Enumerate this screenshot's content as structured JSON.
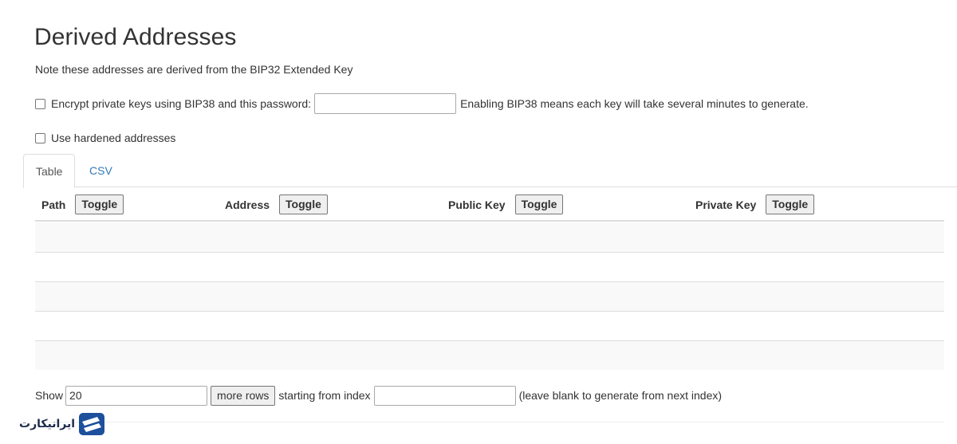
{
  "section": {
    "title": "Derived Addresses",
    "note": "Note these addresses are derived from the BIP32 Extended Key"
  },
  "options": {
    "encrypt_label": "Encrypt private keys using BIP38 and this password:",
    "encrypt_checked": false,
    "password_value": "",
    "encrypt_hint": "Enabling BIP38 means each key will take several minutes to generate.",
    "hardened_label": "Use hardened addresses",
    "hardened_checked": false
  },
  "tabs": [
    {
      "label": "Table",
      "active": true
    },
    {
      "label": "CSV",
      "active": false
    }
  ],
  "table": {
    "columns": [
      {
        "label": "Path",
        "toggle_label": "Toggle"
      },
      {
        "label": "Address",
        "toggle_label": "Toggle"
      },
      {
        "label": "Public Key",
        "toggle_label": "Toggle"
      },
      {
        "label": "Private Key",
        "toggle_label": "Toggle"
      }
    ],
    "rows": []
  },
  "footer": {
    "show_label": "Show",
    "rows_count": "20",
    "more_rows_label": "more rows",
    "starting_label": "starting from index",
    "start_index_value": "",
    "blank_hint": "(leave blank to generate from next index)"
  },
  "watermark": {
    "text": "ایرانیکارت",
    "icon": "iranicard-logo",
    "color": "#1d4f9c"
  },
  "colors": {
    "link": "#337ab7",
    "border": "#dddddd",
    "stripe": "#f9f9f9"
  }
}
